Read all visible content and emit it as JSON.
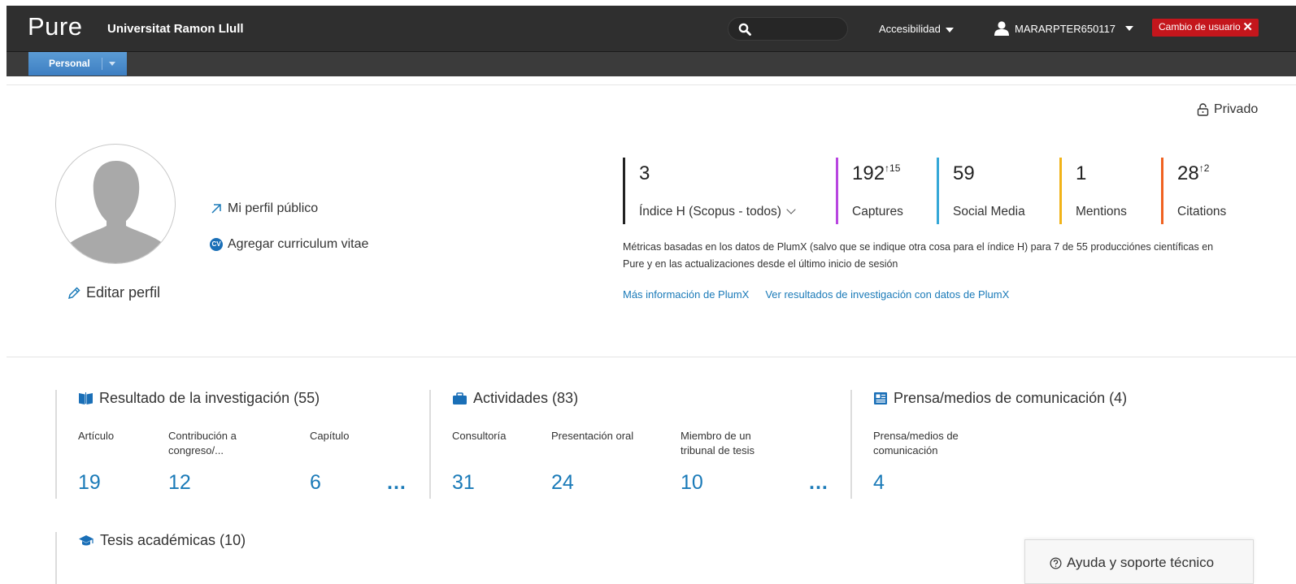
{
  "topbar": {
    "logo": "Pure",
    "organization": "Universitat Ramon Llull",
    "search_placeholder": "",
    "accessibility_label": "Accesibilidad",
    "username": "MARARPTER650117",
    "switch_user_label": "Cambio de usuario",
    "switch_user_close": "✕"
  },
  "subnav": {
    "tab_label": "Personal"
  },
  "profile": {
    "privacy_label": "Privado",
    "public_profile_link": "Mi perfil público",
    "add_cv_link": "Agregar curriculum vitae",
    "cv_badge": "CV",
    "edit_profile": "Editar perfil"
  },
  "metrics": {
    "hindex": {
      "value": "3",
      "label": "Índice H (Scopus - todos)"
    },
    "captures": {
      "value": "192",
      "delta": "↑15",
      "label": "Captures",
      "color": "#b845e0"
    },
    "social_media": {
      "value": "59",
      "label": "Social Media",
      "color": "#34a7d7"
    },
    "mentions": {
      "value": "1",
      "label": "Mentions",
      "color": "#f2b318"
    },
    "citations": {
      "value": "28",
      "delta": "↑2",
      "label": "Citations",
      "color": "#f06220"
    },
    "note": "Métricas basadas en los datos de PlumX (salvo que se indique otra cosa para el índice H) para 7 de 55 producciónes científicas en Pure y en las actualizaciones desde el último inicio de sesión",
    "link_more_info": "Más información de PlumX",
    "link_results": "Ver resultados de investigación con datos de PlumX"
  },
  "sections": {
    "research": {
      "title": "Resultado de la investigación (55)",
      "items": [
        {
          "label": "Artículo",
          "count": "19"
        },
        {
          "label": "Contribución a congreso/...",
          "count": "12"
        },
        {
          "label": "Capítulo",
          "count": "6"
        }
      ],
      "more": "..."
    },
    "activities": {
      "title": "Actividades (83)",
      "items": [
        {
          "label": "Consultoría",
          "count": "31"
        },
        {
          "label": "Presentación oral",
          "count": "24"
        },
        {
          "label": "Miembro de un tribunal de tesis",
          "count": "10"
        }
      ],
      "more": "..."
    },
    "press": {
      "title": "Prensa/medios de comunicación (4)",
      "items": [
        {
          "label": "Prensa/medios de comunicación",
          "count": "4"
        }
      ]
    },
    "theses": {
      "title": "Tesis académicas (10)"
    }
  },
  "help": {
    "label": "Ayuda y soporte técnico"
  },
  "colors": {
    "accent_blue": "#1a7ab8",
    "tab_blue": "#4a8fcf",
    "switch_red": "#c4161c",
    "topbar": "#2f2f2f"
  }
}
